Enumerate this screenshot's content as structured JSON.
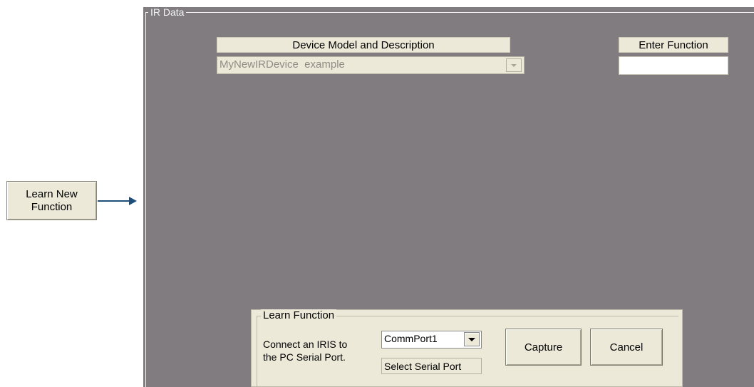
{
  "callout": {
    "button_label_line1": "Learn New",
    "button_label_line2": "Function"
  },
  "panel": {
    "title": "IR Data"
  },
  "device": {
    "header": "Device Model and Description",
    "selected_value": "MyNewIRDevice  example"
  },
  "function": {
    "header": "Enter Function",
    "value": ""
  },
  "learn": {
    "group_title": "Learn Function",
    "instruction_line1": "Connect an IRIS to",
    "instruction_line2": "the PC Serial Port.",
    "port_value": "CommPort1",
    "port_hint": "Select Serial Port",
    "capture_label": "Capture",
    "cancel_label": "Cancel"
  },
  "colors": {
    "panel_bg": "#807c80",
    "control_bg": "#ece9d8",
    "arrow": "#1f4e79"
  },
  "icons": [
    "arrow-right-icon",
    "dropdown-arrow-icon"
  ]
}
